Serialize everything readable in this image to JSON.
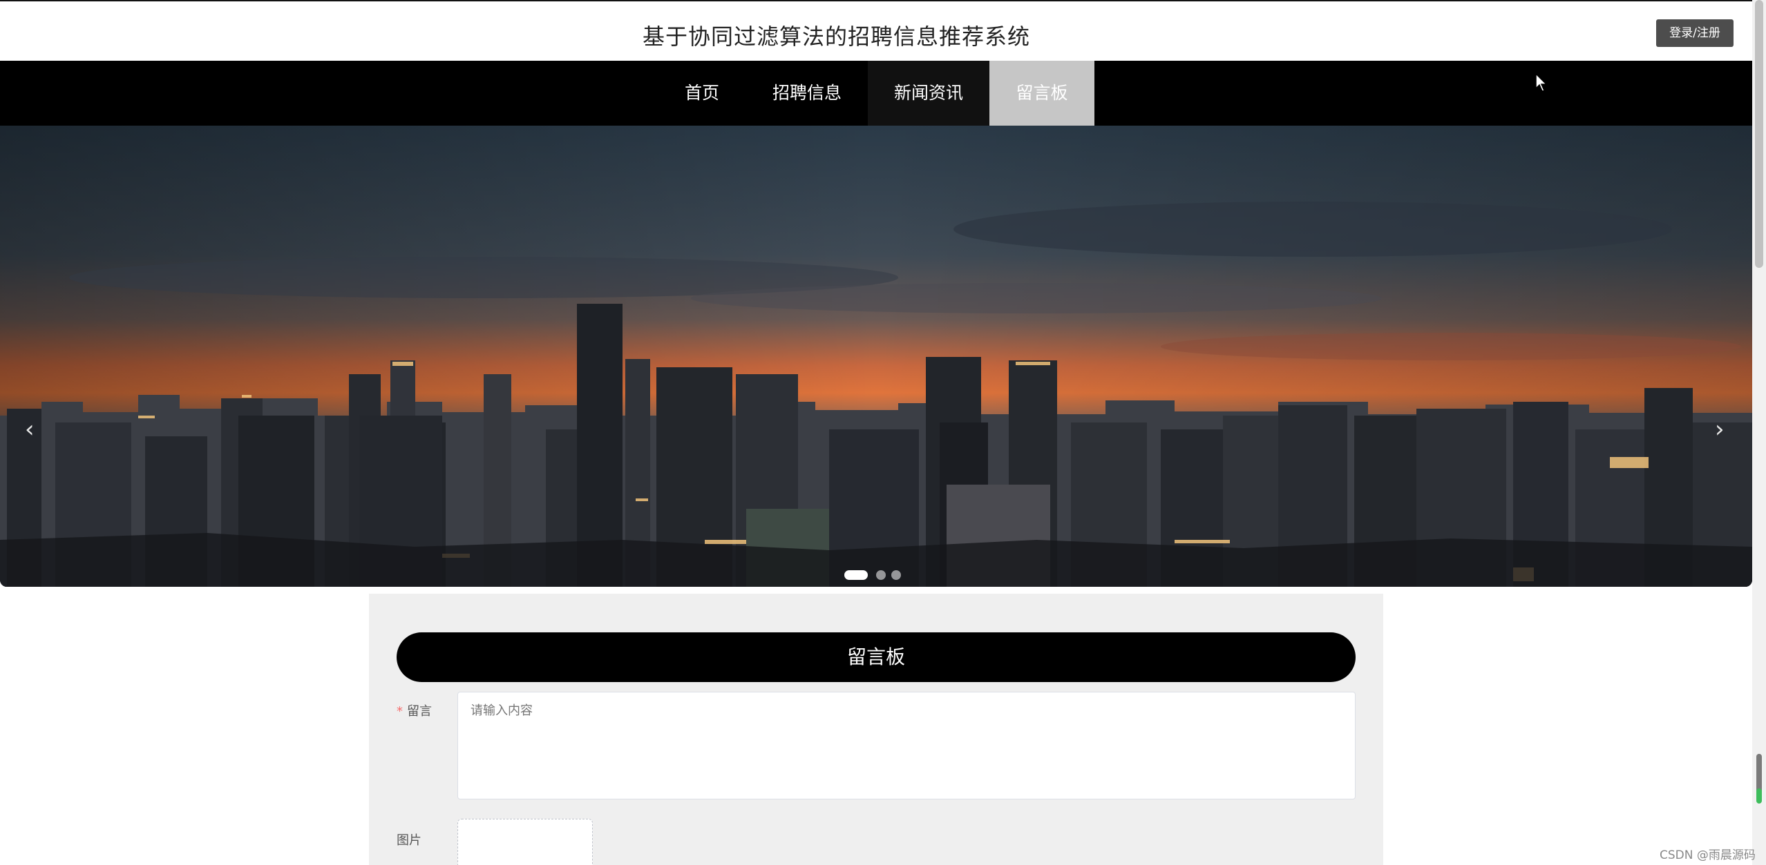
{
  "header": {
    "title": "基于协同过滤算法的招聘信息推荐系统",
    "login_label": "登录/注册"
  },
  "nav": {
    "items": [
      {
        "label": "首页",
        "active": false
      },
      {
        "label": "招聘信息",
        "active": false
      },
      {
        "label": "新闻资讯",
        "active": false
      },
      {
        "label": "留言板",
        "active": true
      }
    ]
  },
  "banner": {
    "prev_label": "‹",
    "next_label": "›",
    "slide_count": 3,
    "active_slide": 1
  },
  "form": {
    "title": "留言板",
    "message_label": "留言",
    "message_required_mark": "*",
    "message_placeholder": "请输入内容",
    "image_label": "图片"
  },
  "watermark": "CSDN @雨晨源码"
}
